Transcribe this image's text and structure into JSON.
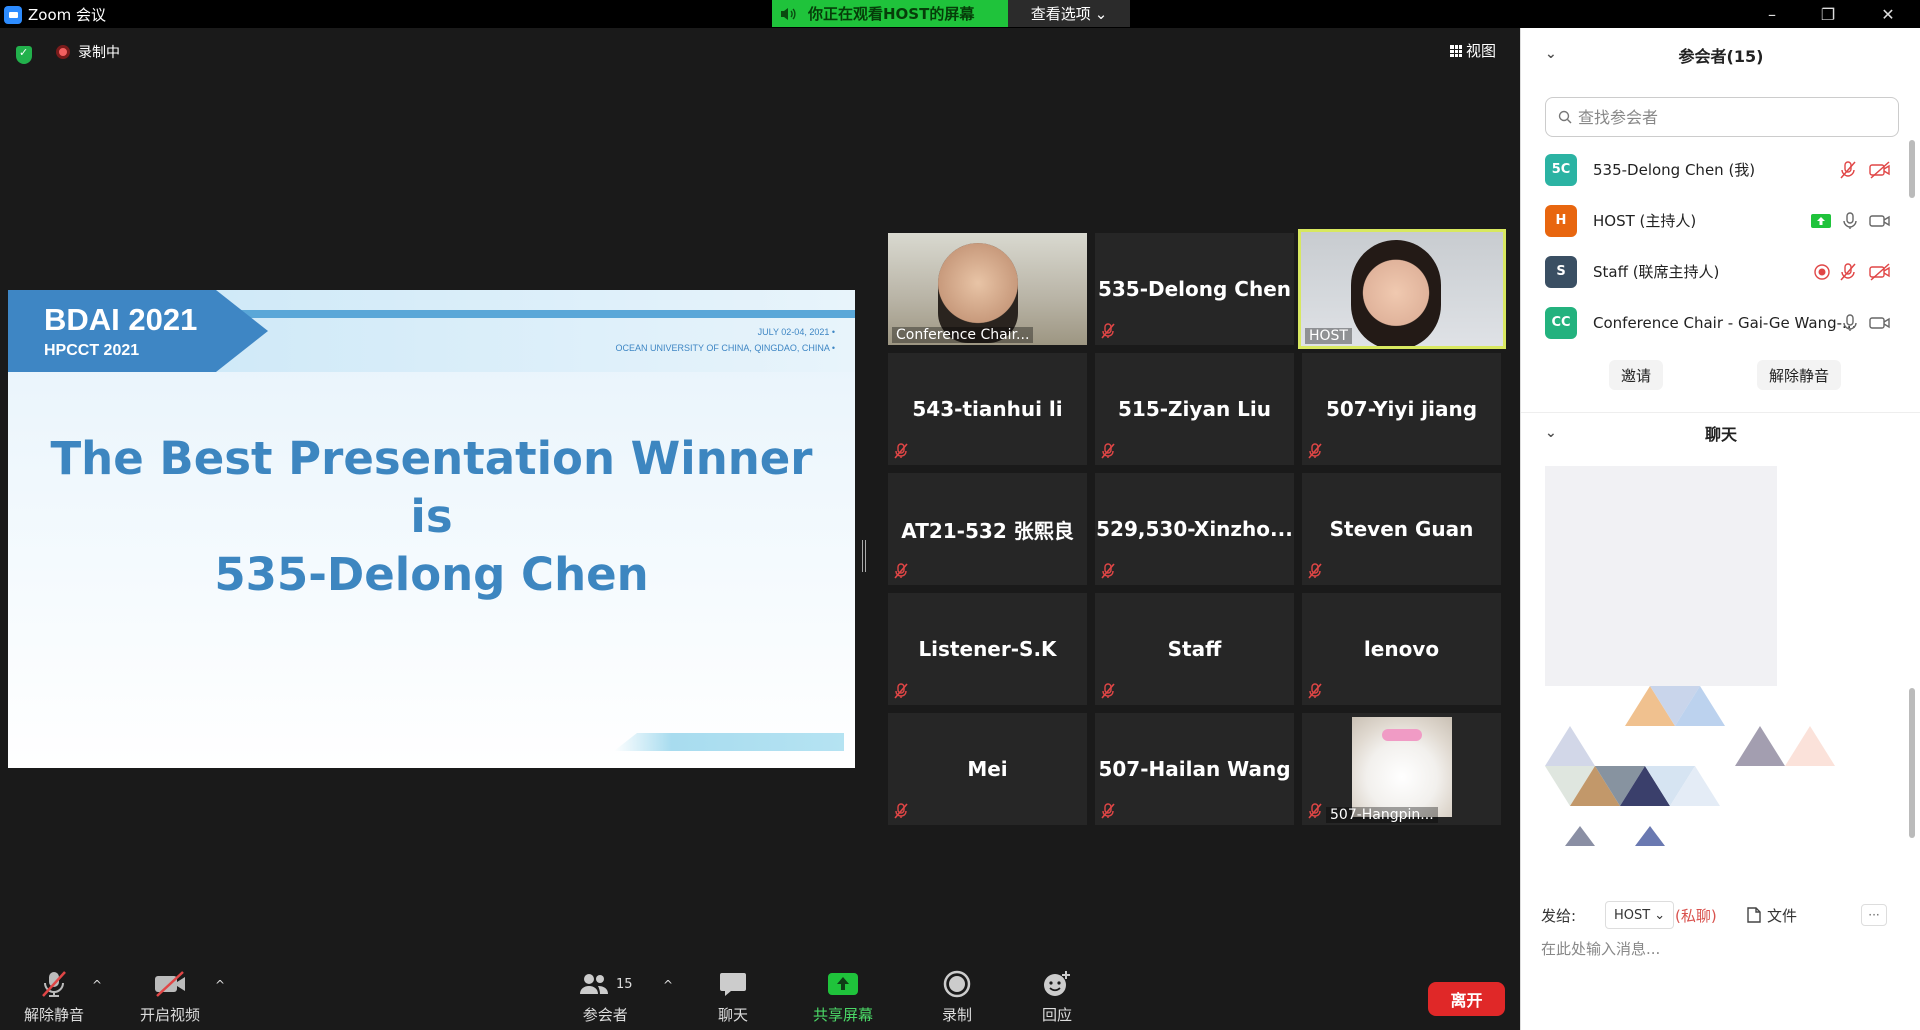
{
  "titlebar": {
    "app_title": "Zoom 会议",
    "share_banner": "你正在观看HOST的屏幕",
    "view_options": "查看选项"
  },
  "meeting": {
    "recording": "录制中",
    "view_label": "视图"
  },
  "slide": {
    "brand": "BDAI 2021",
    "sub_brand": "HPCCT 2021",
    "date_line": "JULY 02-04, 2021 •",
    "venue_line": "OCEAN UNIVERSITY OF CHINA, QINGDAO, CHINA •",
    "title_line1": "The Best Presentation Winner",
    "title_line2": "is",
    "title_line3": "535-Delong Chen"
  },
  "tiles": [
    {
      "name": "Conference Chair...",
      "video": true
    },
    {
      "name": "535-Delong Chen",
      "video": false
    },
    {
      "name": "HOST",
      "video": true
    },
    {
      "name": "543-tianhui li",
      "video": false
    },
    {
      "name": "515-Ziyan Liu",
      "video": false
    },
    {
      "name": "507-Yiyi jiang",
      "video": false
    },
    {
      "name": "AT21-532 张熙良",
      "video": false
    },
    {
      "name": "529,530-Xinzho...",
      "video": false
    },
    {
      "name": "Steven Guan",
      "video": false
    },
    {
      "name": "Listener-S.K",
      "video": false
    },
    {
      "name": "Staff",
      "video": false
    },
    {
      "name": "lenovo",
      "video": false
    },
    {
      "name": "Mei",
      "video": false
    },
    {
      "name": "507-Hailan Wang",
      "video": false
    },
    {
      "name": "507-Hangpin...",
      "video": true
    }
  ],
  "toolbar": {
    "unmute": "解除静音",
    "start_video": "开启视频",
    "participants": "参会者",
    "participant_count": "15",
    "chat": "聊天",
    "share_screen": "共享屏幕",
    "record": "录制",
    "reactions": "回应",
    "leave": "离开"
  },
  "panel": {
    "participants_title": "参会者(15)",
    "search_placeholder": "查找参会者",
    "participants": [
      {
        "initials": "5C",
        "name": "535-Delong Chen (我)",
        "color": "#2bb3a3"
      },
      {
        "initials": "H",
        "name": "HOST (主持人)",
        "color": "#e8660f"
      },
      {
        "initials": "S",
        "name": "Staff (联席主持人)",
        "color": "#3a4f63"
      },
      {
        "initials": "CC",
        "name": "Conference Chair - Gai-Ge Wang-...",
        "color": "#23b27e"
      }
    ],
    "invite": "邀请",
    "unmute_all": "解除静音",
    "chat_title": "聊天",
    "send_to_label": "发给:",
    "send_to_value": "HOST",
    "private": "(私聊)",
    "file": "文件",
    "more": "···",
    "chat_placeholder": "在此处输入消息..."
  },
  "colors": {
    "share_green": "#1fc33b",
    "leave_red": "#e02828",
    "accent_blue": "#3d86c0",
    "host_border": "#d8e860"
  }
}
